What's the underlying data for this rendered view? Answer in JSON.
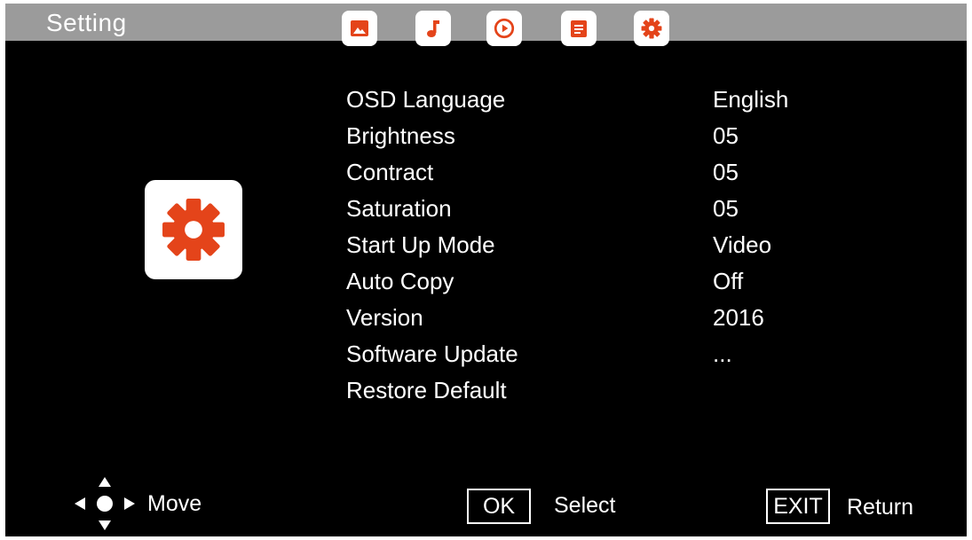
{
  "header": {
    "title": "Setting",
    "tabs": [
      {
        "icon": "image-icon",
        "selected": false
      },
      {
        "icon": "music-note-icon",
        "selected": false
      },
      {
        "icon": "play-circle-icon",
        "selected": false
      },
      {
        "icon": "document-icon",
        "selected": false
      },
      {
        "icon": "gear-icon",
        "selected": true
      }
    ]
  },
  "main": {
    "section_icon": "gear-icon",
    "settings": [
      {
        "label": "OSD Language",
        "value": "English"
      },
      {
        "label": "Brightness",
        "value": "05"
      },
      {
        "label": "Contract",
        "value": "05"
      },
      {
        "label": "Saturation",
        "value": "05"
      },
      {
        "label": "Start Up Mode",
        "value": "Video"
      },
      {
        "label": "Auto Copy",
        "value": "Off"
      },
      {
        "label": "Version",
        "value": "2016"
      },
      {
        "label": "Software Update",
        "value": "..."
      },
      {
        "label": "Restore Default",
        "value": ""
      }
    ]
  },
  "footer": {
    "move_label": "Move",
    "ok_key": "OK",
    "select_label": "Select",
    "exit_key": "EXIT",
    "return_label": "Return"
  },
  "colors": {
    "accent": "#e4441a",
    "topbar": "#9b9b9b",
    "background": "#000000",
    "text": "#ffffff"
  }
}
